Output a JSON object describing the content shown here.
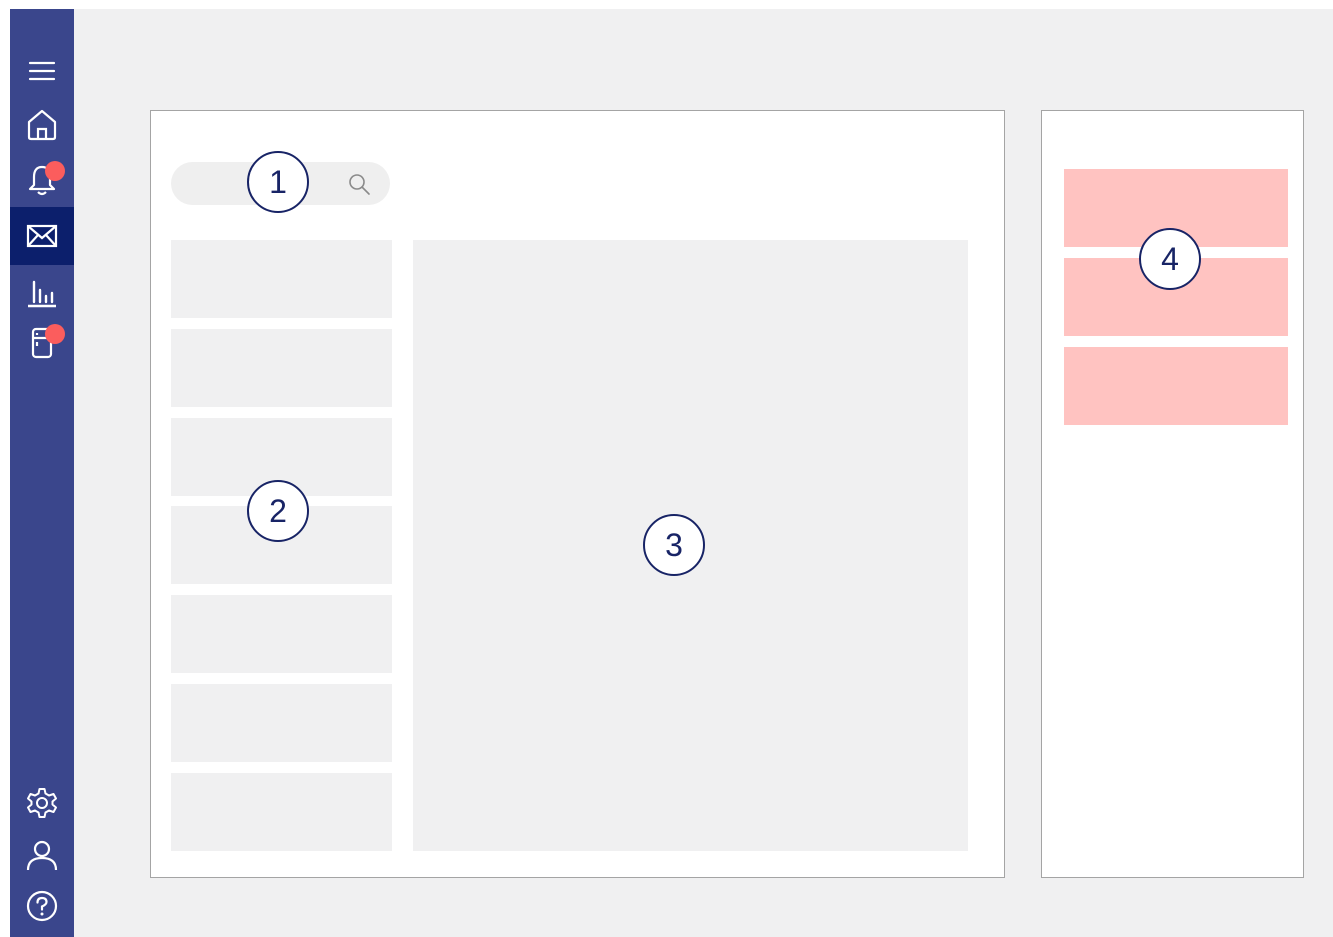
{
  "sidebar": {
    "items": [
      {
        "name": "menu",
        "icon": "menu-icon",
        "active": false,
        "badge": false
      },
      {
        "name": "home",
        "icon": "home-icon",
        "active": false,
        "badge": false
      },
      {
        "name": "notifications",
        "icon": "bell-icon",
        "active": false,
        "badge": true
      },
      {
        "name": "messages",
        "icon": "mail-icon",
        "active": true,
        "badge": false
      },
      {
        "name": "analytics",
        "icon": "bar-chart-icon",
        "active": false,
        "badge": false
      },
      {
        "name": "devices",
        "icon": "fridge-icon",
        "active": false,
        "badge": true
      }
    ],
    "bottom_items": [
      {
        "name": "settings",
        "icon": "gear-icon"
      },
      {
        "name": "profile",
        "icon": "user-icon"
      },
      {
        "name": "help",
        "icon": "question-icon"
      }
    ]
  },
  "search": {
    "placeholder": "",
    "icon": "search-icon"
  },
  "list": {
    "item_count": 7
  },
  "side_panel": {
    "card_count": 3
  },
  "markers": [
    {
      "label": "1"
    },
    {
      "label": "2"
    },
    {
      "label": "3"
    },
    {
      "label": "4"
    }
  ],
  "colors": {
    "sidebar_bg": "#3a468c",
    "sidebar_active": "#0c1f6c",
    "badge": "#fb5d5d",
    "placeholder_gray": "#f0f0f1",
    "card_pink": "#ffc3c1",
    "marker_ink": "#182466"
  }
}
